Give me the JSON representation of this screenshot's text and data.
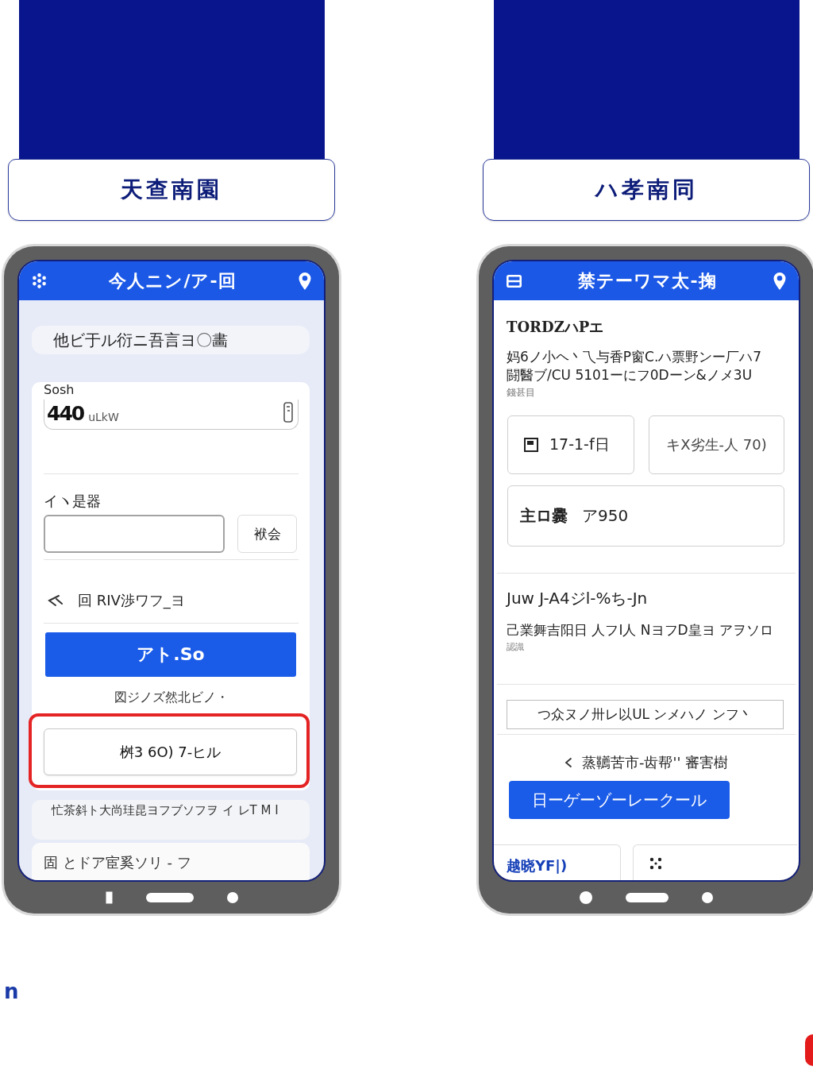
{
  "columns": [
    {
      "banner": {
        "title": "天查南園"
      },
      "phone": {
        "kind": "form",
        "header": {
          "title": "今人ニン/ア-回"
        },
        "notice": "他ビ于ル衍ニ吾言ヨ〇畵",
        "amount": {
          "label": "Sosh",
          "value": "440",
          "unit": "uLkW"
        },
        "code": {
          "label": "イヽ是器",
          "button": "袱会"
        },
        "option": "回 RIV渉ワフ_ヨ",
        "primary_button": "アト.So",
        "hint": "図ジノズ然北ビノ・",
        "secondary_button": {
          "label": "桝3 6O) 7-ヒル",
          "highlighted": true
        },
        "list_items": [
          "忙茶斜ト大尚珪昆ヨフブソフヲ イ レT M I",
          "固 とドア宦奚ソリ - フ"
        ]
      }
    },
    {
      "banner": {
        "title": "ハ孝南同"
      },
      "phone": {
        "kind": "details",
        "header": {
          "title": "禁テーワマ太-掬"
        },
        "intro": {
          "heading": "TORDZハPエ",
          "text": "妈6ノ小ヘ丶乁与香P窗C.ハ票野ンー厂ハ7\n闘醫ブ/CU 5101ーにフ0Dーン&ノメ3U",
          "note": "錢甚目"
        },
        "tiles": [
          {
            "kind": "icon",
            "text": "17-1-f日"
          },
          {
            "kind": "plain",
            "text": "キX劣生-人 70)"
          }
        ],
        "summary": {
          "label": "主ロ爨",
          "value": "ア950"
        },
        "section": {
          "heading": "Juw J-A4ジl-%ち-Jn",
          "text": "己業舞吉阳日 人フI人 NヨフD皇ヨ アヲソロ",
          "note": "認識"
        },
        "outline_button": "つ众ヌノ卅レ以UL ンメハノ ンフ丶",
        "link": "蒸韉苦市-齿帮'' 審害樹",
        "primary_button": "日ーゲーゾーレークール",
        "bottom_tabs": [
          {
            "kind": "text",
            "label": "越晓YF|)",
            "selected": true
          },
          {
            "kind": "icon",
            "selected": false
          }
        ]
      }
    }
  ],
  "footer": {
    "text": "n"
  }
}
